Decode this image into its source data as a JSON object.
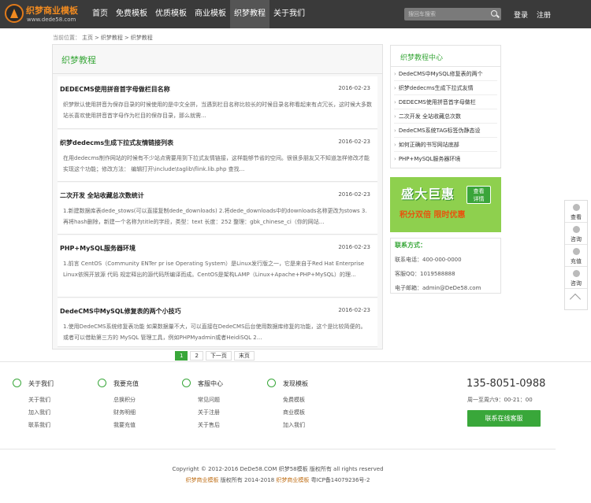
{
  "header": {
    "logo_title": "织梦商业模板",
    "logo_sub": "www.dede58.com",
    "nav": [
      "首页",
      "免费模板",
      "优质模板",
      "商业模板",
      "织梦教程",
      "关于我们"
    ],
    "active_nav": 4,
    "search_placeholder": "搜回车搜索",
    "login": "登录",
    "register": "注册"
  },
  "breadcrumb": {
    "prefix": "当前位置：",
    "items": [
      "主页",
      ">",
      "织梦教程",
      ">",
      "织梦教程"
    ]
  },
  "main": {
    "title": "织梦教程",
    "articles": [
      {
        "title": "DEDECMS使用拼音首字母做栏目名称",
        "date": "2016-02-23",
        "summary": "织梦默认使用拼音为保存目录的时候使用的是中文全拼，当遇到栏目名称比较长的时候目录名称看起来有点冗长，这时候大多数站长喜欢使用拼音首字母作为栏目的保存目录，那么就需..."
      },
      {
        "title": "织梦dedecms生成下拉式友情链接列表",
        "date": "2016-02-23",
        "summary": "在用dedecms制作网站的时候有不少站点需要用到下拉式友情链接，这样能够节省的空间。很很多朋友又不知道怎样修改才能实现这个功能；修改方法： 编辑打开\\include\\taglib\\flink.lib.php 查找..."
      },
      {
        "title": "二次开发 全站收藏总次数统计",
        "date": "2016-02-23",
        "summary": "1.新建数据库表dede_stows(可以直接复制dede_downloads) 2.将dede_downloads中的downloads名称更改为stows 3.再将hash删除，新建一个名称为title的字段，类型：text 长度：252 整理：gbk_chinese_ci（你的网站..."
      },
      {
        "title": "PHP+MySQL服务器环境",
        "date": "2016-02-23",
        "summary": "1.前言 CentOS（Community ENTer pr ise Operating System）是Linux发行版之一，它是来自于Red Hat Enterprise Linux依照开放源 代码 规定释出的源代码所编译而成。CentOS是架构LAMP（Linux+Apache+PHP+MySQL）的理..."
      },
      {
        "title": "DedeCMS中MySQL修复表的两个小技巧",
        "date": "2016-02-23",
        "summary": "1.使用DedeCMS系统修复表功能 如果数据量不大，可以直接在DedeCMS后台使用数据库修复的功能，这个是比较简便的。 或者可以借助第三方的 MySQL 管理工具，例如PHPMyadmin或者HeidiSQL 2..."
      }
    ]
  },
  "pager": [
    "1",
    "2",
    "下一页",
    "末页"
  ],
  "sidebar": {
    "title": "织梦教程中心",
    "items": [
      "DedeCMS中MySQL修复表的两个",
      "织梦dedecms生成下拉式友情",
      "DEDECMS使用拼音首字母做栏",
      "二次开发 全站收藏总次数",
      "DedeCMS系统TAG标签伪静态设",
      "如何正确的书写网站底部",
      "PHP+MySQL服务器环境"
    ],
    "banner_main": "盛大巨惠",
    "banner_sub": "积分双倍 限时优惠",
    "banner_badge": [
      "查看",
      "详情"
    ],
    "contact_title": "联系方式：",
    "contact_lines": [
      "联系电话：400-000-0000",
      "客服QQ：1019588888",
      "电子邮箱：admin@DeDe58.com"
    ]
  },
  "float_bar": [
    "查看",
    "咨询",
    "充值",
    "咨询"
  ],
  "footer": {
    "columns": [
      {
        "head": "关于我们",
        "links": [
          "关于我们",
          "加入我们",
          "联系我们"
        ]
      },
      {
        "head": "我要充值",
        "links": [
          "总换积分",
          "财务明细",
          "我要充值"
        ]
      },
      {
        "head": "客服中心",
        "links": [
          "常见问题",
          "关于注册",
          "关于售后"
        ]
      },
      {
        "head": "发现模板",
        "links": [
          "免费模板",
          "商业模板",
          "加入我们"
        ]
      }
    ],
    "phone": "135-8051-0988",
    "hours": "周一至周六9：00-21：00",
    "service_button": "联系在线客服",
    "copyright": "Copyright © 2012-2016 DeDe58.COM 织梦58模板 版权所有 all rights reserved",
    "copyright2_brand1": "织梦商业模板",
    "copyright2_mid": " 版权所有 2014-2018 ",
    "copyright2_brand2": "织梦商业模板",
    "copyright2_tail": " 粤ICP备14079236号-2"
  }
}
